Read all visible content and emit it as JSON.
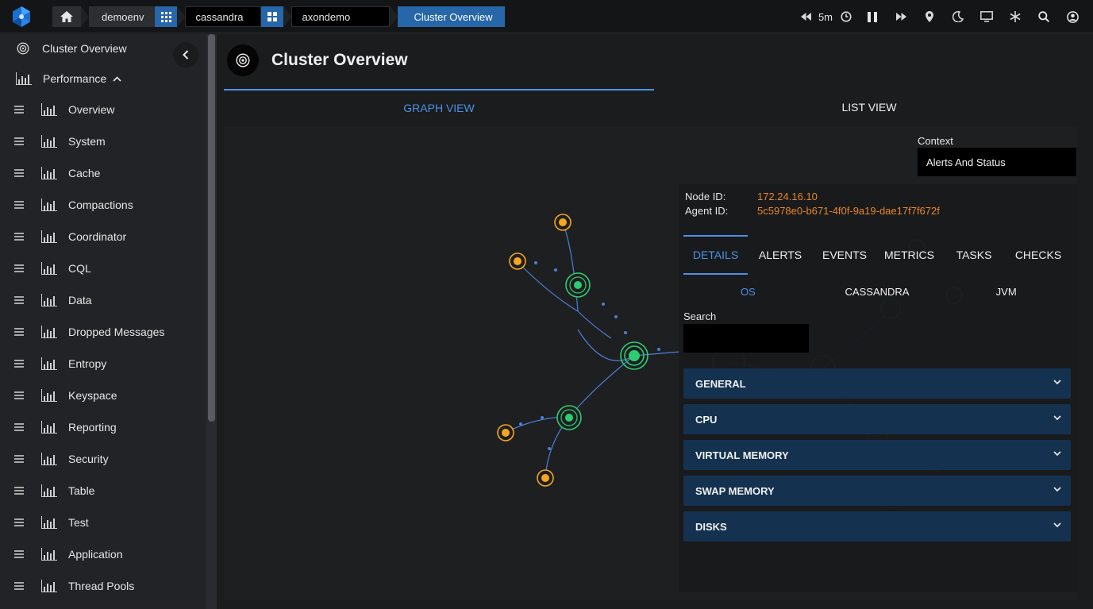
{
  "topbar": {
    "breadcrumbs": {
      "env": "demoenv",
      "cluster_type": "cassandra",
      "cluster": "axondemo",
      "page": "Cluster Overview"
    },
    "time_range": "5m"
  },
  "sidebar": {
    "header": "Cluster Overview",
    "section": "Performance",
    "items": [
      {
        "label": "Overview"
      },
      {
        "label": "System"
      },
      {
        "label": "Cache"
      },
      {
        "label": "Compactions"
      },
      {
        "label": "Coordinator"
      },
      {
        "label": "CQL"
      },
      {
        "label": "Data"
      },
      {
        "label": "Dropped Messages"
      },
      {
        "label": "Entropy"
      },
      {
        "label": "Keyspace"
      },
      {
        "label": "Reporting"
      },
      {
        "label": "Security"
      },
      {
        "label": "Table"
      },
      {
        "label": "Test"
      },
      {
        "label": "Application"
      },
      {
        "label": "Thread Pools"
      }
    ]
  },
  "main": {
    "title": "Cluster Overview",
    "tabs": {
      "graph": "GRAPH VIEW",
      "list": "LIST VIEW"
    },
    "context": {
      "label": "Context",
      "value": "Alerts And Status"
    }
  },
  "node_panel": {
    "node_id_label": "Node ID:",
    "node_id": "172.24.16.10",
    "agent_id_label": "Agent ID:",
    "agent_id": "5c5978e0-b671-4f0f-9a19-dae17f7f672f",
    "tabs": [
      "DETAILS",
      "ALERTS",
      "EVENTS",
      "METRICS",
      "TASKS",
      "CHECKS"
    ],
    "subtabs": [
      "OS",
      "CASSANDRA",
      "JVM"
    ],
    "search_label": "Search",
    "sections": [
      "GENERAL",
      "CPU",
      "VIRTUAL MEMORY",
      "SWAP MEMORY",
      "DISKS"
    ]
  },
  "colors": {
    "accent": "#4b91e6",
    "node_ok": "#2ecc71",
    "node_warn": "#f5a623",
    "id_value": "#e8862a",
    "section_bg": "#14324f"
  }
}
